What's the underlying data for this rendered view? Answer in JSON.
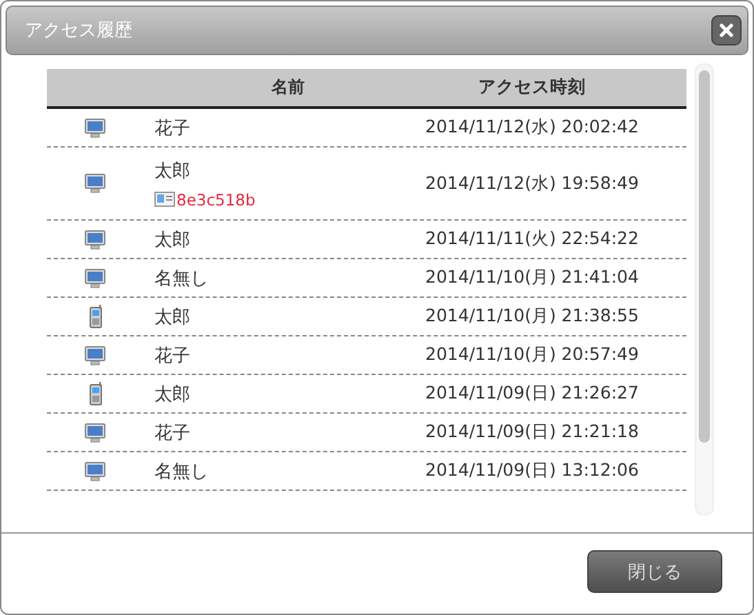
{
  "window": {
    "title": "アクセス履歴"
  },
  "table": {
    "columns": [
      "名前",
      "アクセス時刻"
    ],
    "rows": [
      {
        "kind": "pc",
        "name": "花子",
        "time": "2014/11/12(水) 20:02:42"
      },
      {
        "kind": "pc",
        "name": "太郎",
        "tag": "8e3c518b",
        "time": "2014/11/12(水) 19:58:49"
      },
      {
        "kind": "pc",
        "name": "太郎",
        "time": "2014/11/11(火) 22:54:22"
      },
      {
        "kind": "pc",
        "name": "名無し",
        "time": "2014/11/10(月) 21:41:04"
      },
      {
        "kind": "phone",
        "name": "太郎",
        "time": "2014/11/10(月) 21:38:55"
      },
      {
        "kind": "pc",
        "name": "花子",
        "time": "2014/11/10(月) 20:57:49"
      },
      {
        "kind": "phone",
        "name": "太郎",
        "time": "2014/11/09(日) 21:26:27"
      },
      {
        "kind": "pc",
        "name": "花子",
        "time": "2014/11/09(日) 21:21:18"
      },
      {
        "kind": "pc",
        "name": "名無し",
        "time": "2014/11/09(日) 13:12:06"
      }
    ]
  },
  "buttons": [
    "閉じる"
  ]
}
